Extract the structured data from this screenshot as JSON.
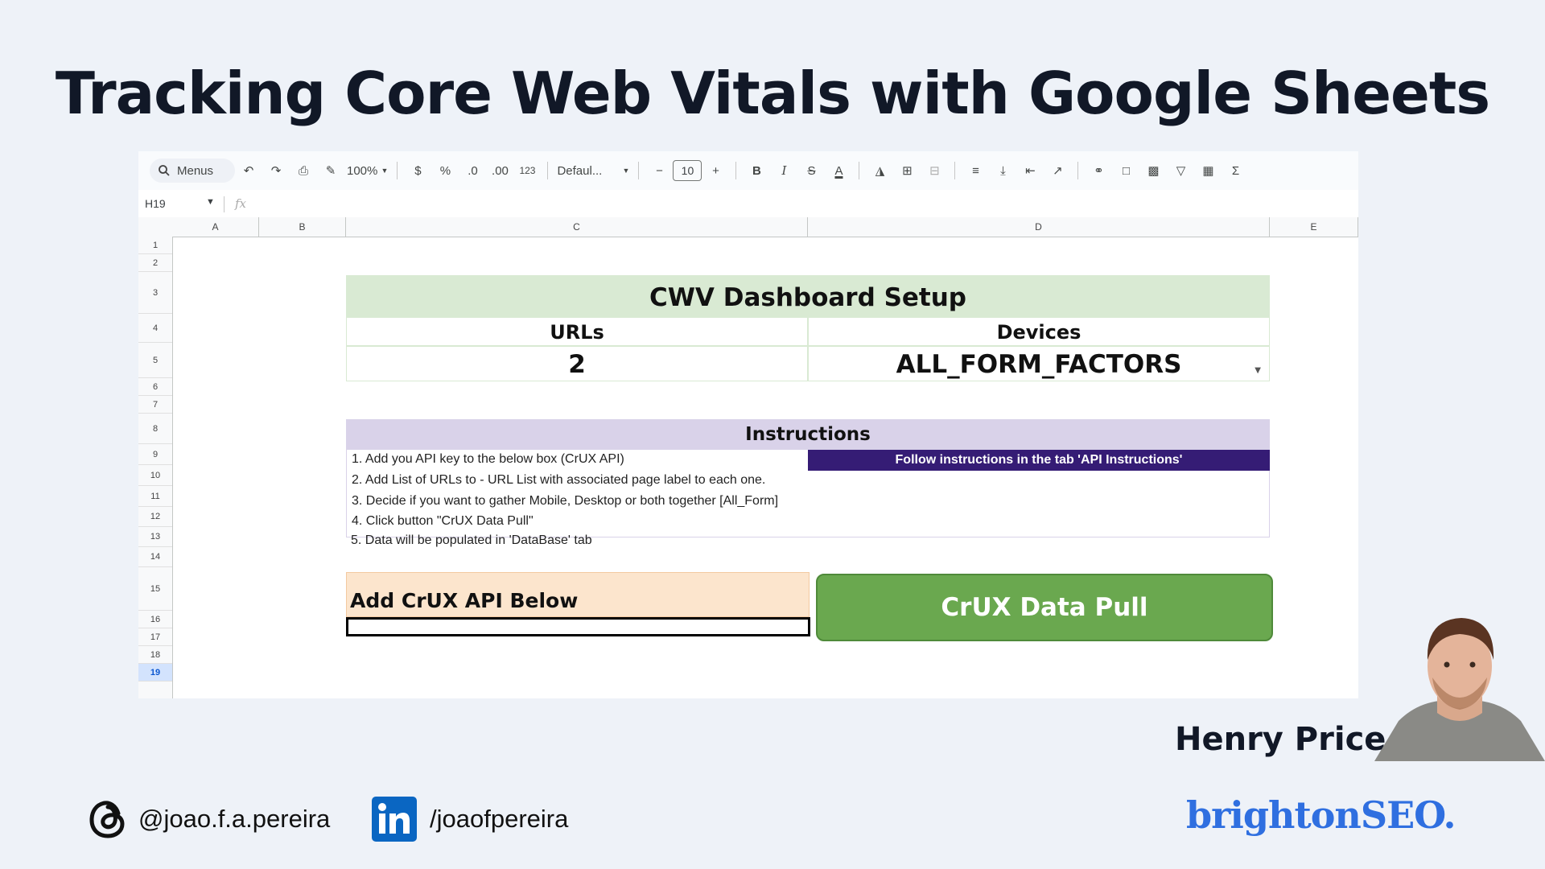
{
  "slide": {
    "title": "Tracking Core Web Vitals with Google Sheets"
  },
  "sheet": {
    "toolbar": {
      "menus_label": "Menus",
      "zoom": "100%",
      "currency": "$",
      "percent": "%",
      "dec_decrease": ".0",
      "dec_increase": ".00",
      "number_format": "123",
      "font": "Defaul...",
      "font_size": "10",
      "bold": "B",
      "italic": "I"
    },
    "name_box": "H19",
    "fx_label": "fx",
    "columns": [
      "A",
      "B",
      "C",
      "D",
      "E"
    ],
    "rows": [
      "1",
      "2",
      "3",
      "4",
      "5",
      "6",
      "7",
      "8",
      "9",
      "10",
      "11",
      "12",
      "13",
      "14",
      "15",
      "16",
      "17",
      "18",
      "19"
    ],
    "selected_row": "19",
    "dashboard": {
      "title": "CWV Dashboard Setup",
      "urls_label": "URLs",
      "devices_label": "Devices",
      "urls_value": "2",
      "devices_value": "ALL_FORM_FACTORS"
    },
    "instructions": {
      "title": "Instructions",
      "lines": [
        "1. Add you API key to the below box (CrUX API)",
        "2. Add List of URLs to - URL List with associated page label to each one.",
        "3. Decide if you want to gather Mobile, Desktop or both together [All_Form]",
        "4. Click button \"CrUX Data Pull\"",
        "5. Data will be populated in 'DataBase' tab"
      ],
      "follow_note": "Follow instructions in the tab 'API Instructions'"
    },
    "api": {
      "label": "Add CrUX API Below",
      "value": ""
    },
    "pull_button": "CrUX Data Pull"
  },
  "speaker": {
    "name": "Henry Price"
  },
  "footer": {
    "threads_handle": "@joao.f.a.pereira",
    "linkedin_handle": "/joaofpereira",
    "brand": "brightonSEO."
  },
  "colors": {
    "background": "#eef2f8",
    "cwv_header": "#d9ead3",
    "instructions_header": "#d9d2e9",
    "follow_bg": "#351c75",
    "api_bg": "#fce5cd",
    "pull_button": "#6aa84f",
    "brand": "#2f6fe0",
    "linkedin": "#0a66c2"
  }
}
